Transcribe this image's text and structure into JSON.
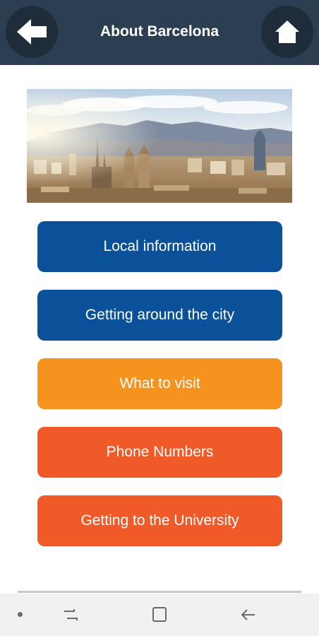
{
  "header": {
    "title": "About Barcelona",
    "back_icon": "back-arrow-icon",
    "home_icon": "home-icon"
  },
  "hero": {
    "image": "barcelona-skyline-photo"
  },
  "menu": {
    "items": [
      {
        "label": "Local information",
        "color": "#0a519a"
      },
      {
        "label": "Getting around the city",
        "color": "#0a519a"
      },
      {
        "label": "What to visit",
        "color": "#f6931e"
      },
      {
        "label": "Phone Numbers",
        "color": "#f05a28"
      },
      {
        "label": "Getting to the University",
        "color": "#f05a28"
      }
    ]
  },
  "nav_bar": {
    "icons": [
      "recent-apps-icon",
      "home-square-icon",
      "back-icon"
    ]
  },
  "colors": {
    "header_bg": "#2c3e52",
    "header_button_bg": "#1f2c3a",
    "blue": "#0a519a",
    "yellow": "#f6931e",
    "orange": "#f05a28"
  }
}
